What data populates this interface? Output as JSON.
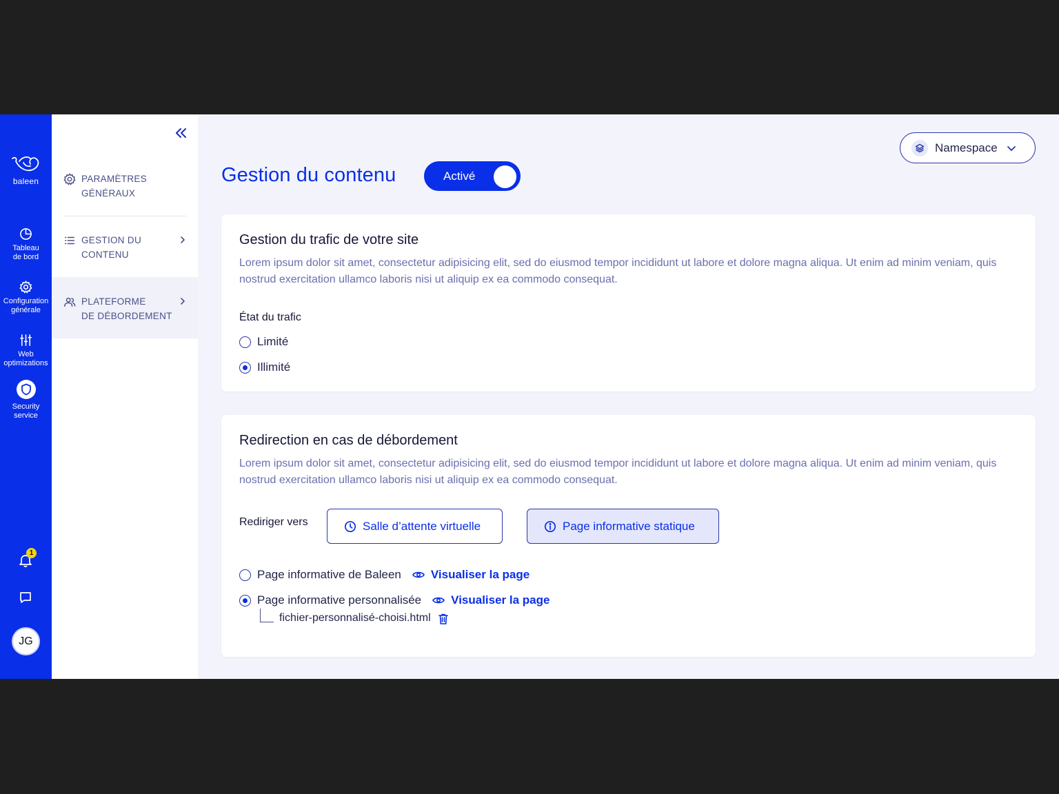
{
  "brand": {
    "logo_text": "baleen",
    "accent": "#0a2fe8"
  },
  "rail": {
    "items": [
      {
        "label": "Tableau de bord",
        "icon": "pie-chart-icon"
      },
      {
        "label": "Configuration générale",
        "icon": "gear-icon"
      },
      {
        "label": "Web optimizations",
        "icon": "sliders-icon"
      },
      {
        "label": "Security service",
        "icon": "shield-icon",
        "active": true
      }
    ],
    "notifications_count": "1",
    "avatar_initials": "JG"
  },
  "subnav": {
    "items": [
      {
        "line1": "PARAMÈTRES",
        "line2": "GÉNÉRAUX",
        "icon": "gear-icon"
      },
      {
        "line1": "GESTION DU",
        "line2": "CONTENU",
        "icon": "list-icon"
      },
      {
        "line1": "PLATEFORME",
        "line2": "DE DÉBORDEMENT",
        "icon": "users-icon",
        "selected": true
      }
    ]
  },
  "header": {
    "title": "Gestion du contenu",
    "toggle_label": "Activé",
    "namespace_label": "Namespace"
  },
  "traffic": {
    "title": "Gestion du trafic de votre site",
    "description": "Lorem ipsum dolor sit amet, consectetur adipisicing elit, sed do eiusmod tempor incididunt ut labore et dolore magna aliqua. Ut enim ad minim veniam, quis nostrud exercitation ullamco laboris nisi ut aliquip ex ea commodo consequat.",
    "state_label": "État du trafic",
    "options": [
      {
        "label": "Limité",
        "checked": false
      },
      {
        "label": "Illimité",
        "checked": true
      }
    ]
  },
  "redirect": {
    "title": "Redirection en cas de débordement",
    "description": "Lorem ipsum dolor sit amet, consectetur adipisicing elit, sed do eiusmod tempor incididunt ut labore et dolore magna aliqua. Ut enim ad minim veniam, quis nostrud exercitation ullamco laboris nisi ut aliquip ex ea commodo consequat.",
    "redirect_label": "Rediriger vers",
    "option_waiting_room": "Salle d’attente virtuelle",
    "option_static_page": "Page informative statique",
    "pages": [
      {
        "label": "Page informative de Baleen",
        "checked": false,
        "link": "Visualiser la page"
      },
      {
        "label": "Page informative personnalisée",
        "checked": true,
        "link": "Visualiser la page"
      }
    ],
    "file_name": "fichier-personnalisé-choisi.html"
  }
}
